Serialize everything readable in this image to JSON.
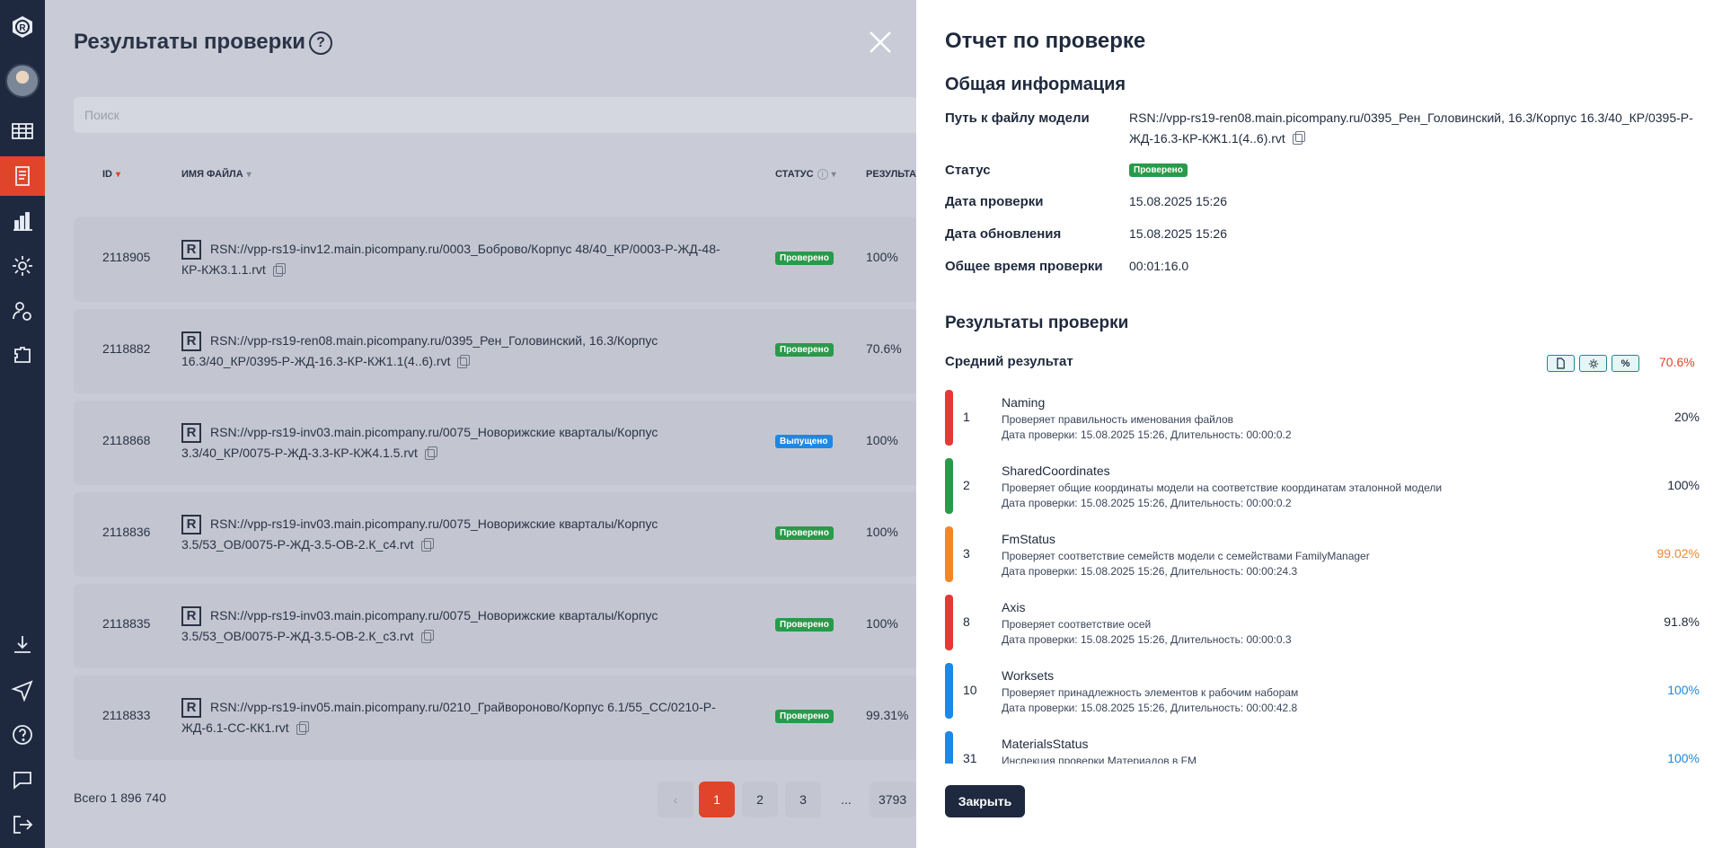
{
  "left": {
    "title": "Результаты проверки",
    "help_glyph": "?",
    "search_placeholder": "Поиск",
    "columns": {
      "id": "ID",
      "file": "ИМЯ ФАЙЛА",
      "status": "СТАТУС",
      "result": "РЕЗУЛЬТАТ"
    },
    "rows": [
      {
        "id": "2118905",
        "file": "RSN://vpp-rs19-inv12.main.picompany.ru/0003_Боброво/Корпус 48/40_КР/0003-Р-ЖД-48-КР-КЖ3.1.1.rvt",
        "status": "Проверено",
        "result": "100%"
      },
      {
        "id": "2118882",
        "file": "RSN://vpp-rs19-ren08.main.picompany.ru/0395_Рен_Головинский, 16.3/Корпус 16.3/40_КР/0395-Р-ЖД-16.3-КР-КЖ1.1(4..6).rvt",
        "status": "Проверено",
        "result": "70.6%"
      },
      {
        "id": "2118868",
        "file": "RSN://vpp-rs19-inv03.main.picompany.ru/0075_Новорижские кварталы/Корпус 3.3/40_КР/0075-Р-ЖД-3.3-КР-КЖ4.1.5.rvt",
        "status": "Выпущено",
        "result": "100%"
      },
      {
        "id": "2118836",
        "file": "RSN://vpp-rs19-inv03.main.picompany.ru/0075_Новорижские кварталы/Корпус 3.5/53_ОВ/0075-Р-ЖД-3.5-ОВ-2.К_с4.rvt",
        "status": "Проверено",
        "result": "100%"
      },
      {
        "id": "2118835",
        "file": "RSN://vpp-rs19-inv03.main.picompany.ru/0075_Новорижские кварталы/Корпус 3.5/53_ОВ/0075-Р-ЖД-3.5-ОВ-2.К_с3.rvt",
        "status": "Проверено",
        "result": "100%"
      },
      {
        "id": "2118833",
        "file": "RSN://vpp-rs19-inv05.main.picompany.ru/0210_Грайвороново/Корпус 6.1/55_СС/0210-Р-ЖД-6.1-СС-КК1.rvt",
        "status": "Проверено",
        "result": "99.31%"
      }
    ],
    "total": "Всего 1 896 740",
    "pages": [
      "1",
      "2",
      "3",
      "...",
      "3793"
    ],
    "logo_letter": "R"
  },
  "report": {
    "title": "Отчет по проверке",
    "general_heading": "Общая информация",
    "path_label": "Путь к файлу модели",
    "path_value": "RSN://vpp-rs19-ren08.main.picompany.ru/0395_Рен_Головинский, 16.3/Корпус 16.3/40_КР/0395-Р-ЖД-16.3-КР-КЖ1.1(4..6).rvt",
    "status_label": "Статус",
    "status_value": "Проверено",
    "check_date_label": "Дата проверки",
    "check_date_value": "15.08.2025 15:26",
    "update_date_label": "Дата обновления",
    "update_date_value": "15.08.2025 15:26",
    "total_time_label": "Общее время проверки",
    "total_time_value": "00:01:16.0",
    "results_heading": "Результаты проверки",
    "avg_label": "Средний результат",
    "avg_value": "70.6%",
    "percent_glyph": "%",
    "checks": [
      {
        "num": "1",
        "name": "Naming",
        "desc": "Проверяет правильность именования файлов",
        "date": "Дата проверки: 15.08.2025 15:26, Длительность: 00:00:0.2",
        "result": "20%",
        "color": "#e53935",
        "result_color": "#1f2a3d"
      },
      {
        "num": "2",
        "name": "SharedCoordinates",
        "desc": "Проверяет общие координаты модели на соответствие координатам эталонной модели",
        "date": "Дата проверки: 15.08.2025 15:26, Длительность: 00:00:0.2",
        "result": "100%",
        "color": "#2a9a4a",
        "result_color": "#1f2a3d"
      },
      {
        "num": "3",
        "name": "FmStatus",
        "desc": "Проверяет соответствие семейств модели с семействами FamilyManager",
        "date": "Дата проверки: 15.08.2025 15:26, Длительность: 00:00:24.3",
        "result": "99.02%",
        "color": "#f0882a",
        "result_color": "#f0882a"
      },
      {
        "num": "8",
        "name": "Axis",
        "desc": "Проверяет соответствие осей",
        "date": "Дата проверки: 15.08.2025 15:26, Длительность: 00:00:0.3",
        "result": "91.8%",
        "color": "#e53935",
        "result_color": "#1f2a3d"
      },
      {
        "num": "10",
        "name": "Worksets",
        "desc": "Проверяет принадлежность элементов к рабочим наборам",
        "date": "Дата проверки: 15.08.2025 15:26, Длительность: 00:00:42.8",
        "result": "100%",
        "color": "#1e88e5",
        "result_color": "#1e88e5"
      },
      {
        "num": "31",
        "name": "MaterialsStatus",
        "desc": "Инспекция проверки Материалов в FM",
        "date": "",
        "result": "100%",
        "color": "#1e88e5",
        "result_color": "#1e88e5"
      }
    ],
    "close_label": "Закрыть"
  }
}
